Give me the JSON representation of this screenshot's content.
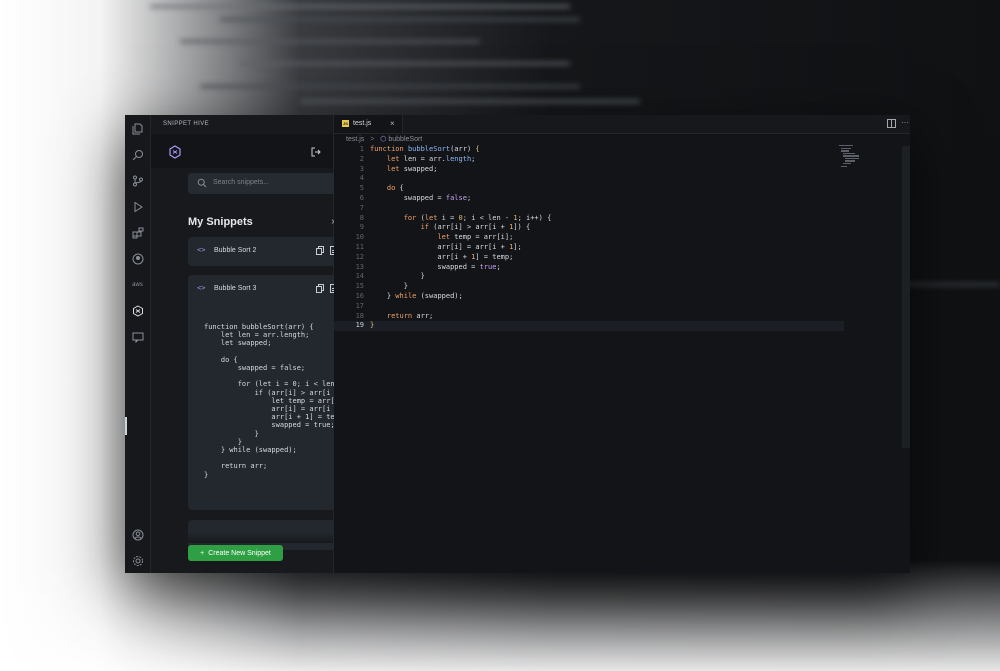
{
  "sidebar": {
    "panel_title": "SNIPPET HIVE",
    "search_placeholder": "Search snippets...",
    "section_title": "My Snippets",
    "close_symbol": "×",
    "snippets": [
      {
        "name": "Bubble Sort 2"
      },
      {
        "name": "Bubble Sort 3",
        "preview": "function bubbleSort(arr) {\n    let len = arr.length;\n    let swapped;\n\n    do {\n        swapped = false;\n\n        for (let i = 0; i < len\n            if (arr[i] > arr[i +\n                let temp = arr[i\n                arr[i] = arr[i +\n                arr[i + 1] = tem\n                swapped = true;\n            }\n        }\n    } while (swapped);\n\n    return arr;\n}"
      }
    ],
    "new_button_label": "Create New Snippet",
    "new_button_icon": "+"
  },
  "editor": {
    "tab_label": "test.js",
    "tab_badge": "JS",
    "tab_close": "×",
    "more_symbol": "···",
    "breadcrumb": [
      "test.js",
      "bubbleSort"
    ],
    "current_line": 19,
    "line_numbers": [
      "1",
      "2",
      "3",
      "4",
      "5",
      "6",
      "7",
      "8",
      "9",
      "10",
      "11",
      "12",
      "13",
      "14",
      "15",
      "16",
      "17",
      "18",
      "19"
    ]
  },
  "colors": {
    "accent_green": "#2ea043",
    "logo_purple": "#a89bf5",
    "keyword": "#f0a368",
    "function": "#8fb6f3",
    "number": "#e8b76a"
  },
  "icons": [
    "files-icon",
    "search-icon",
    "source-control-icon",
    "run-debug-icon",
    "extensions-icon",
    "github-icon",
    "aws-icon",
    "snippet-hive-icon",
    "chat-icon",
    "account-icon",
    "settings-icon",
    "logout-icon",
    "copy-icon",
    "file-icon",
    "split-editor-icon",
    "code-icon"
  ]
}
